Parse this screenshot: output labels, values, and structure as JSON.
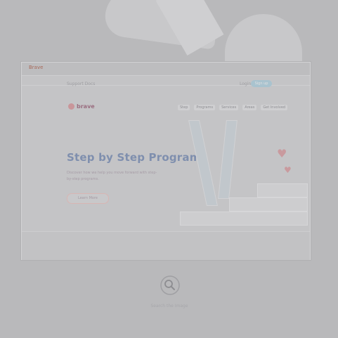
{
  "browser": {
    "tab_title": "Brave",
    "utility_left": "Support   Docs",
    "utility_right": "Login",
    "utility_button": "Sign up"
  },
  "site": {
    "logo": "brave",
    "nav": [
      "Step",
      "Programs",
      "Services",
      "Areas",
      "Get Involved"
    ]
  },
  "hero": {
    "title": "Step by Step Programs",
    "subtitle": "Discover how we help you move forward with step-by-step programs.",
    "button": "Learn More"
  },
  "zoom": {
    "label": "Search the Image"
  },
  "colors": {
    "background": "#b9b9bb",
    "hero_title": "#7f8fae",
    "logo_accent": "#c9969a",
    "button_accent": "#a9c3cf"
  },
  "icons": {
    "zoom": "magnifier-icon",
    "logo": "brave-logo-icon",
    "decor": "heart-icon"
  }
}
